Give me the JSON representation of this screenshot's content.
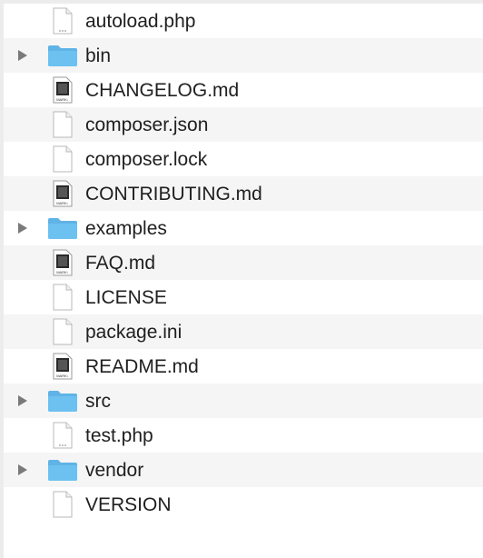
{
  "file_list": {
    "items": [
      {
        "name": "autoload.php",
        "kind": "php",
        "icon": "php-file-icon",
        "expandable": false
      },
      {
        "name": "bin",
        "kind": "folder",
        "icon": "folder-icon",
        "expandable": true
      },
      {
        "name": "CHANGELOG.md",
        "kind": "markdown",
        "icon": "markdown-file-icon",
        "expandable": false
      },
      {
        "name": "composer.json",
        "kind": "doc",
        "icon": "document-icon",
        "expandable": false
      },
      {
        "name": "composer.lock",
        "kind": "doc",
        "icon": "document-icon",
        "expandable": false
      },
      {
        "name": "CONTRIBUTING.md",
        "kind": "markdown",
        "icon": "markdown-file-icon",
        "expandable": false
      },
      {
        "name": "examples",
        "kind": "folder",
        "icon": "folder-icon",
        "expandable": true
      },
      {
        "name": "FAQ.md",
        "kind": "markdown",
        "icon": "markdown-file-icon",
        "expandable": false
      },
      {
        "name": "LICENSE",
        "kind": "doc",
        "icon": "document-icon",
        "expandable": false
      },
      {
        "name": "package.ini",
        "kind": "doc",
        "icon": "document-icon",
        "expandable": false
      },
      {
        "name": "README.md",
        "kind": "markdown",
        "icon": "markdown-file-icon",
        "expandable": false
      },
      {
        "name": "src",
        "kind": "folder",
        "icon": "folder-icon",
        "expandable": true
      },
      {
        "name": "test.php",
        "kind": "php",
        "icon": "php-file-icon",
        "expandable": false
      },
      {
        "name": "vendor",
        "kind": "folder",
        "icon": "folder-icon",
        "expandable": true
      },
      {
        "name": "VERSION",
        "kind": "doc",
        "icon": "document-icon",
        "expandable": false
      }
    ]
  },
  "icon_labels": {
    "markdown": "MARK↓"
  },
  "colors": {
    "folder": "#6cc1f0",
    "folder_tab": "#5fb3e6",
    "disclosure": "#7a7a7a"
  }
}
